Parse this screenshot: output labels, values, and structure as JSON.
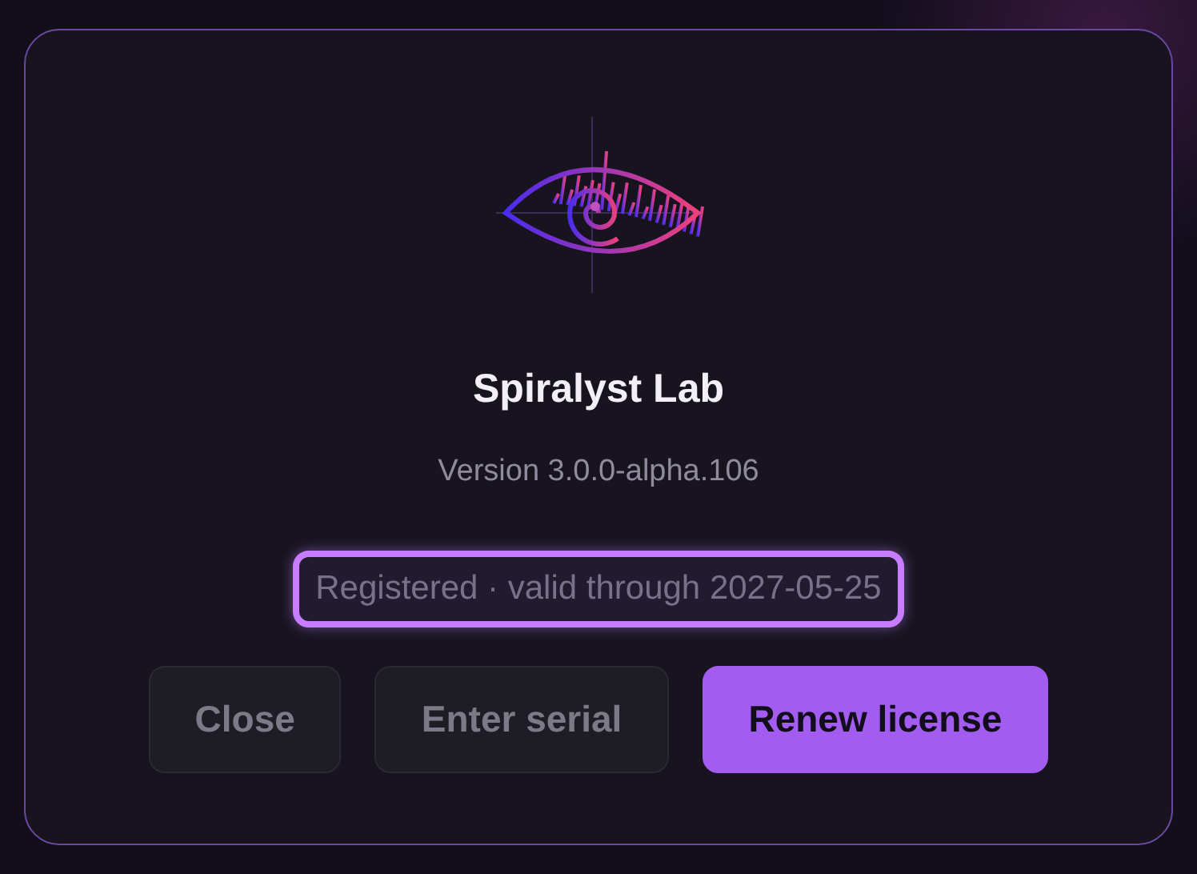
{
  "dialog": {
    "app_name": "Spiralyst Lab",
    "version": "Version 3.0.0-alpha.106",
    "status": {
      "text": "Registered · valid through 2027-05-25",
      "focused": true
    },
    "buttons": [
      {
        "label": "Close",
        "kind": "secondary"
      },
      {
        "label": "Enter serial",
        "kind": "secondary"
      },
      {
        "label": "Renew license",
        "kind": "primary"
      }
    ]
  }
}
